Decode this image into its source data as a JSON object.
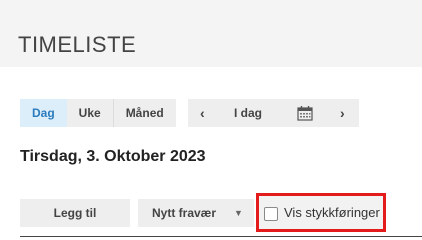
{
  "header": {
    "title": "TIMELISTE"
  },
  "view_toggle": {
    "day": "Dag",
    "week": "Uke",
    "month": "Måned",
    "active": "Dag",
    "active_color": "#2b7bbd"
  },
  "date_nav": {
    "prev": "‹",
    "today": "I dag",
    "calendar_icon": "calendar-icon",
    "next": "›"
  },
  "date_heading": "Tirsdag, 3. Oktober 2023",
  "actions": {
    "add": "Legg til",
    "new_absence": "Nytt fravær",
    "absence_caret": "▼"
  },
  "piece_work_checkbox": {
    "label": "Vis stykkføringer",
    "checked": false,
    "highlight_color": "#e31b1b"
  }
}
